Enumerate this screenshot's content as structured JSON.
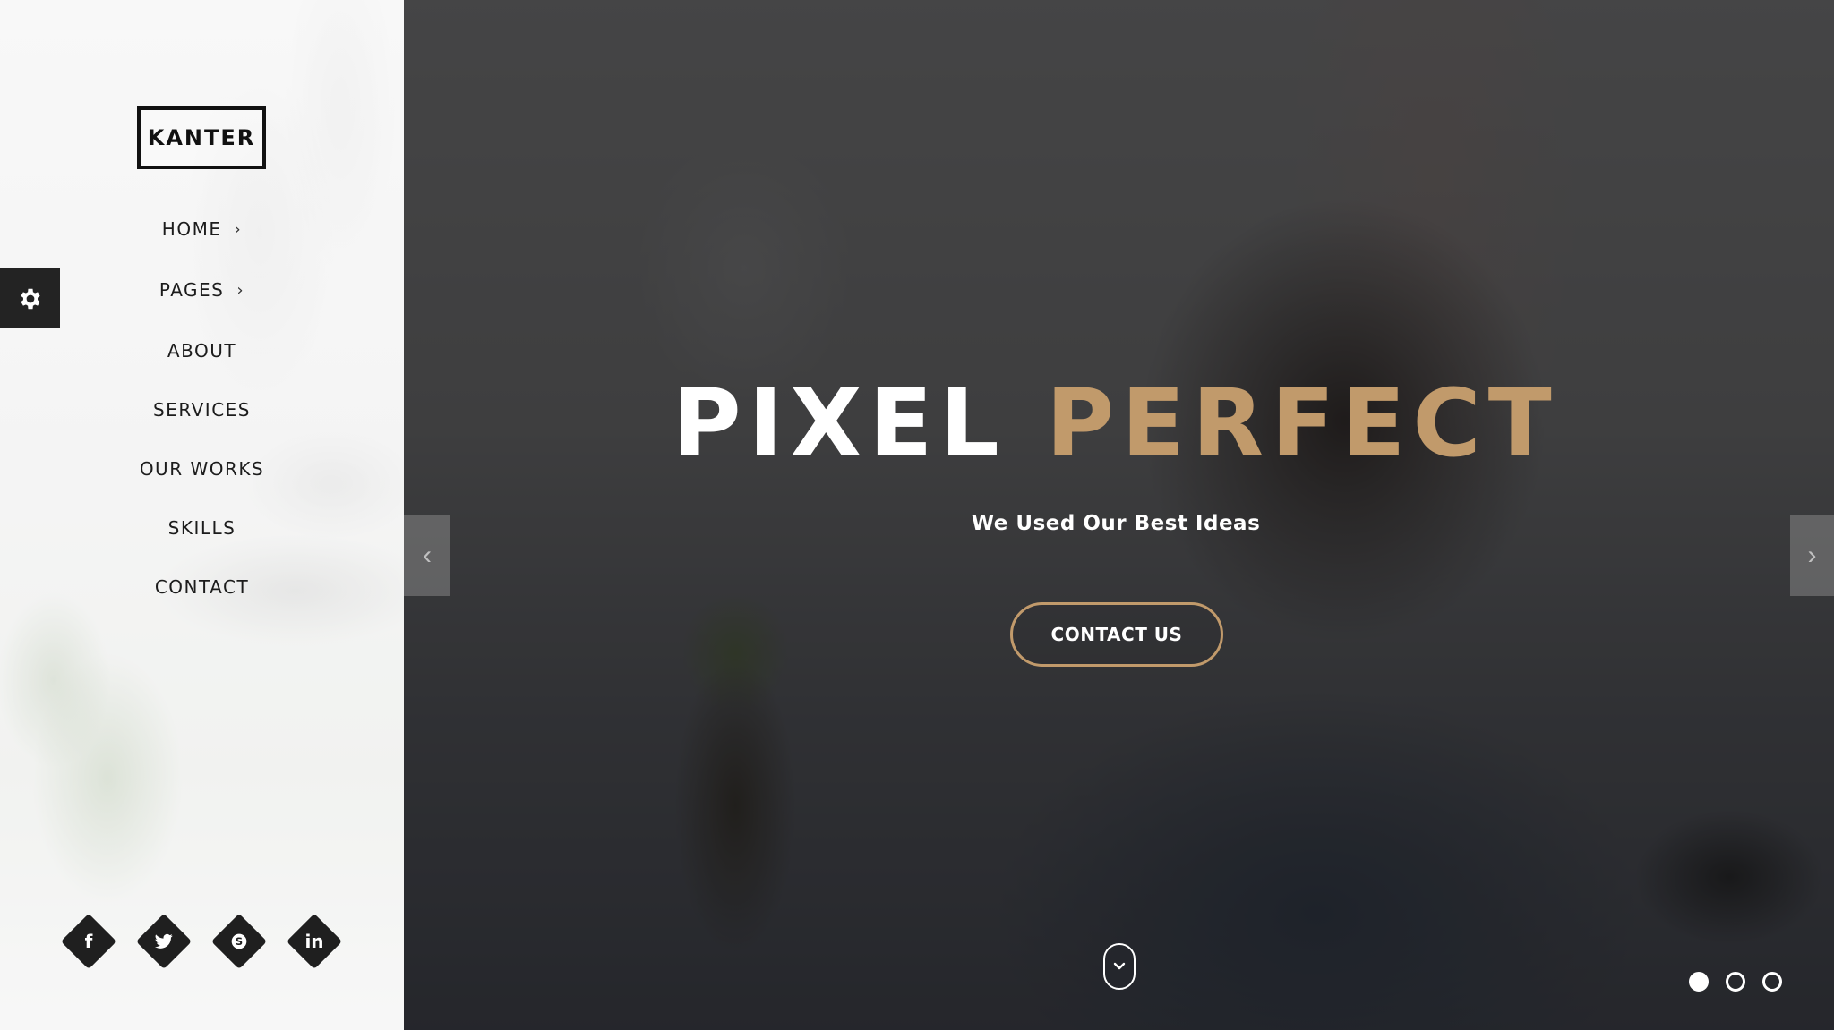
{
  "brand": {
    "logo_text": "KANTER"
  },
  "sidebar": {
    "settings_icon": "gear-icon",
    "nav": [
      {
        "label": "HOME",
        "has_submenu": true
      },
      {
        "label": "PAGES",
        "has_submenu": true
      },
      {
        "label": "ABOUT",
        "has_submenu": false
      },
      {
        "label": "SERVICES",
        "has_submenu": false
      },
      {
        "label": "OUR WORKS",
        "has_submenu": false
      },
      {
        "label": "SKILLS",
        "has_submenu": false
      },
      {
        "label": "CONTACT",
        "has_submenu": false
      }
    ],
    "chevron_glyph": "›",
    "social": [
      {
        "icon": "facebook-icon",
        "glyph": "f"
      },
      {
        "icon": "twitter-icon",
        "glyph": "t"
      },
      {
        "icon": "skype-icon",
        "glyph": "S"
      },
      {
        "icon": "linkedin-icon",
        "glyph": "in"
      }
    ]
  },
  "hero": {
    "title_part1": "PIXEL",
    "title_part2": "PERFECT",
    "subtitle": "We Used Our Best Ideas",
    "cta_label": "CONTACT US",
    "prev_glyph": "‹",
    "next_glyph": "›",
    "slide_count": 3,
    "active_slide": 1
  },
  "colors": {
    "accent": "#c19a6b",
    "sidebar_dark": "#1f1f1f",
    "hero_text": "#ffffff"
  }
}
